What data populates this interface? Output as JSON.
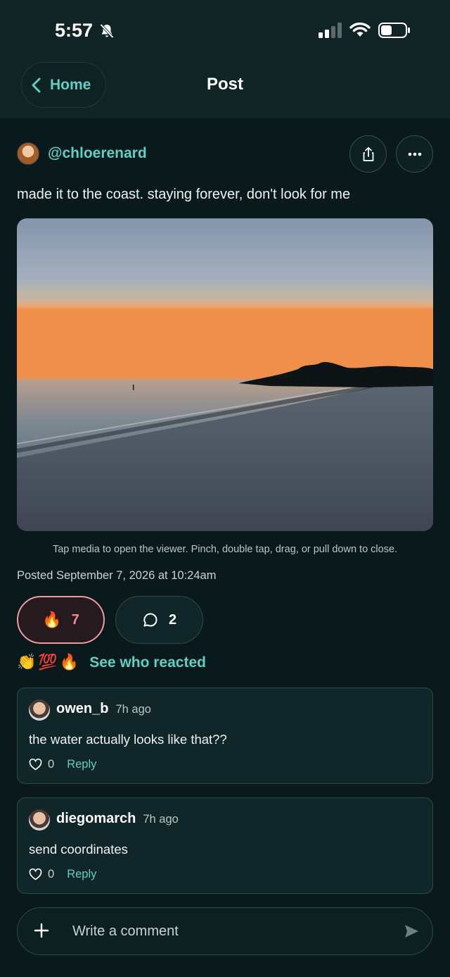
{
  "status_bar": {
    "time": "5:57",
    "bell_icon": "bell-slash-icon",
    "signal_icon": "cellular-signal-icon",
    "wifi_icon": "wifi-icon",
    "battery_icon": "battery-icon"
  },
  "header": {
    "back_label": "Home",
    "title": "Post"
  },
  "post": {
    "author": "@chloerenard",
    "caption": "made it to the coast. staying forever, don't look for me",
    "media_hint": "Tap media to open the viewer. Pinch, double tap, drag, or pull down to close.",
    "posted": "Posted September 7, 2026 at 10:24am",
    "reaction_emoji": "🔥",
    "reaction_count": "7",
    "comment_count": "2"
  },
  "reactions_summary": {
    "emojis": [
      "👏",
      "💯",
      "🔥"
    ],
    "link_label": "See who reacted"
  },
  "comments": [
    {
      "user": "owen_b",
      "time": "7h ago",
      "text": "the water actually looks like that??",
      "likes": "0",
      "reply_label": "Reply"
    },
    {
      "user": "diegomarch",
      "time": "7h ago",
      "text": "send coordinates",
      "likes": "0",
      "reply_label": "Reply"
    }
  ],
  "composer": {
    "placeholder": "Write a comment"
  },
  "colors": {
    "accent": "#5fd0c3",
    "reaction_pink": "#f28a96",
    "background": "#0a1a1c"
  }
}
